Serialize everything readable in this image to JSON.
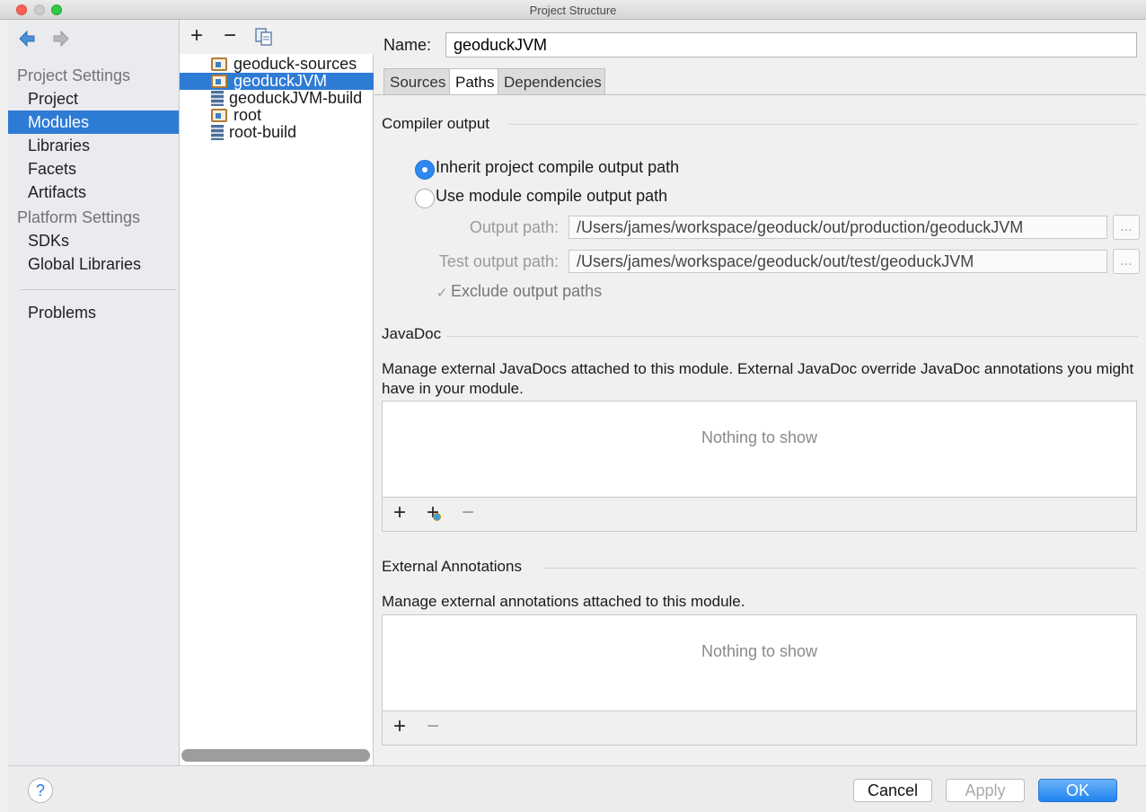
{
  "window": {
    "title": "Project Structure"
  },
  "nav": {
    "project_settings_header": "Project Settings",
    "platform_settings_header": "Platform Settings",
    "items": [
      {
        "label": "Project",
        "selected": false
      },
      {
        "label": "Modules",
        "selected": true
      },
      {
        "label": "Libraries",
        "selected": false
      },
      {
        "label": "Facets",
        "selected": false
      },
      {
        "label": "Artifacts",
        "selected": false
      }
    ],
    "platform_items": [
      {
        "label": "SDKs"
      },
      {
        "label": "Global Libraries"
      }
    ],
    "problems_label": "Problems"
  },
  "tree": {
    "toolbar": {
      "add": "+",
      "remove": "−"
    },
    "items": [
      {
        "label": "geoduck-sources",
        "icon": "module-folder-icon"
      },
      {
        "label": "geoduckJVM",
        "icon": "module-folder-icon",
        "selected": true
      },
      {
        "label": "geoduckJVM-build",
        "icon": "library-icon"
      },
      {
        "label": "root",
        "icon": "module-folder-icon"
      },
      {
        "label": "root-build",
        "icon": "library-icon"
      }
    ]
  },
  "module": {
    "name_label": "Name:",
    "name_value": "geoduckJVM",
    "tabs": [
      "Sources",
      "Paths",
      "Dependencies"
    ],
    "active_tab": "Paths",
    "compiler_output_title": "Compiler output",
    "inherit_label": "Inherit project compile output path",
    "use_module_label": "Use module compile output path",
    "output_path_label": "Output path:",
    "output_path_value": "/Users/james/workspace/geoduck/out/production/geoduckJVM",
    "test_output_path_label": "Test output path:",
    "test_output_path_value": "/Users/james/workspace/geoduck/out/test/geoduckJVM",
    "browse_label": "...",
    "exclude_label": "Exclude output paths",
    "javadoc_title": "JavaDoc",
    "javadoc_desc": "Manage external JavaDocs attached to this module. External JavaDoc override JavaDoc annotations you might have in your module.",
    "empty_text": "Nothing to show",
    "annotations_title": "External Annotations",
    "annotations_desc": "Manage external annotations attached to this module."
  },
  "buttons": {
    "help": "?",
    "cancel": "Cancel",
    "apply": "Apply",
    "ok": "OK"
  },
  "colors": {
    "selection": "#2e7bd6",
    "ok_button": "#1f84f0"
  }
}
